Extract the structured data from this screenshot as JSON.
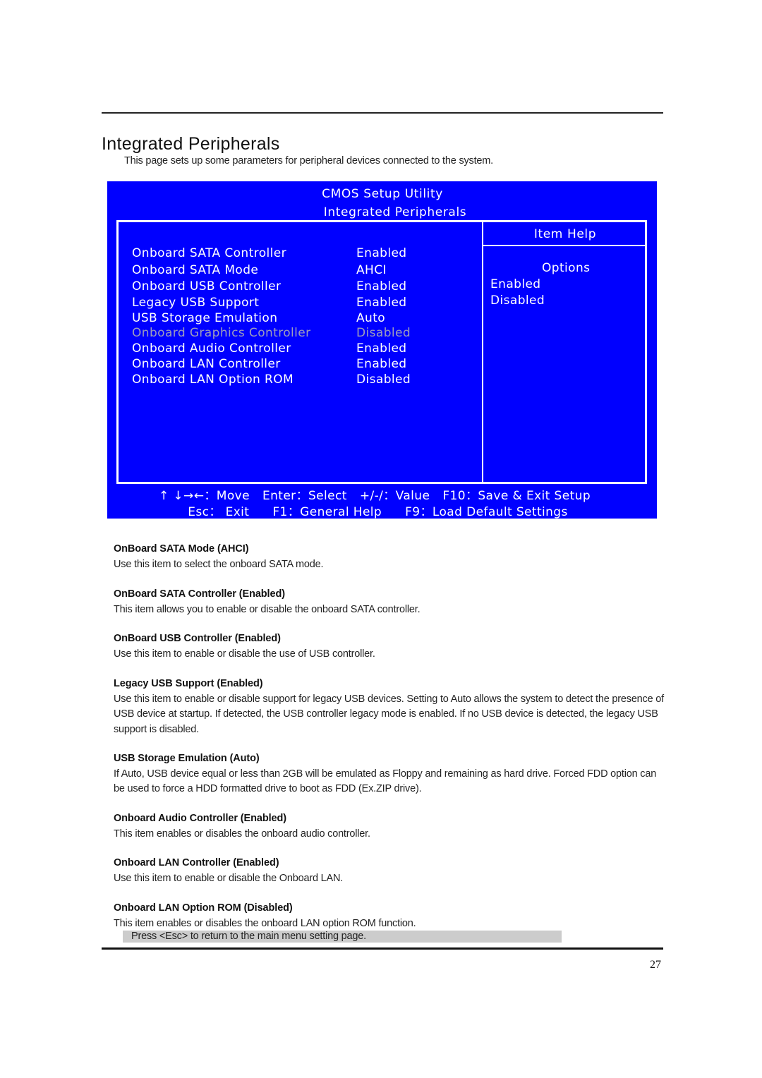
{
  "page": {
    "title": "Integrated Peripherals",
    "intro": "This page sets up some parameters for peripheral devices connected to the system.",
    "page_number": "27",
    "esc_note": "Press <Esc> to return to the main menu setting page."
  },
  "bios": {
    "utility_title": "CMOS Setup Utility",
    "screen_title": "Integrated Peripherals",
    "colors": {
      "background": "#0000ff",
      "text": "#ffffff",
      "disabled_text": "#9d9dbb"
    },
    "items": [
      {
        "label": "Onboard SATA Controller",
        "value": "Enabled",
        "disabled": false
      },
      {
        "label": "Onboard SATA Mode",
        "value": "AHCI",
        "disabled": false
      },
      {
        "label": "Onboard USB Controller",
        "value": "Enabled",
        "disabled": false
      },
      {
        "label": "Legacy USB Support",
        "value": "Enabled",
        "disabled": false
      },
      {
        "label": "USB Storage Emulation",
        "value": "Auto",
        "disabled": false
      },
      {
        "label": "Onboard Graphics Controller",
        "value": "Disabled",
        "disabled": true
      },
      {
        "label": "Onboard Audio Controller",
        "value": "Enabled",
        "disabled": false
      },
      {
        "label": "Onboard LAN Controller",
        "value": "Enabled",
        "disabled": false
      },
      {
        "label": "Onboard LAN Option ROM",
        "value": "Disabled",
        "disabled": false
      }
    ],
    "help": {
      "title": "Item Help",
      "options_title": "Options",
      "options": [
        "Enabled",
        "Disabled"
      ]
    },
    "footer": {
      "move": "↑ ↓→←：Move",
      "select": "Enter：Select",
      "value": "+/-/：Value",
      "save_exit": "F10：Save & Exit Setup",
      "exit": "Esc： Exit",
      "general_help": "F1：General Help",
      "load_defaults": "F9：Load Default Settings"
    }
  },
  "sections": [
    {
      "heading": "OnBoard SATA Mode (AHCI)",
      "body": "Use this item to select the onboard SATA mode."
    },
    {
      "heading": "OnBoard SATA Controller (Enabled)",
      "body": "This item allows you to enable or disable the onboard SATA controller."
    },
    {
      "heading": "OnBoard USB Controller (Enabled)",
      "body": "Use this item to enable or disable the use of USB controller."
    },
    {
      "heading": "Legacy USB Support (Enabled)",
      "body": "Use this item to enable or disable support for legacy USB devices. Setting to Auto allows the system to detect the presence of USB device at startup. If detected, the USB controller legacy mode is enabled. If no USB device is detected, the legacy USB support is disabled."
    },
    {
      "heading": "USB Storage Emulation (Auto)",
      "body": "If Auto, USB device equal or less than 2GB will be emulated as Floppy and remaining as hard drive. Forced FDD option can be used to force a HDD formatted drive to boot as FDD (Ex.ZIP drive)."
    },
    {
      "heading": "Onboard Audio Controller (Enabled)",
      "body": "This item enables or disables the onboard audio controller."
    },
    {
      "heading": "Onboard LAN Controller (Enabled)",
      "body": "Use this item to enable or disable the Onboard LAN."
    },
    {
      "heading": "Onboard LAN Option ROM (Disabled)",
      "body": "This item enables or disables the onboard LAN option ROM function."
    }
  ]
}
